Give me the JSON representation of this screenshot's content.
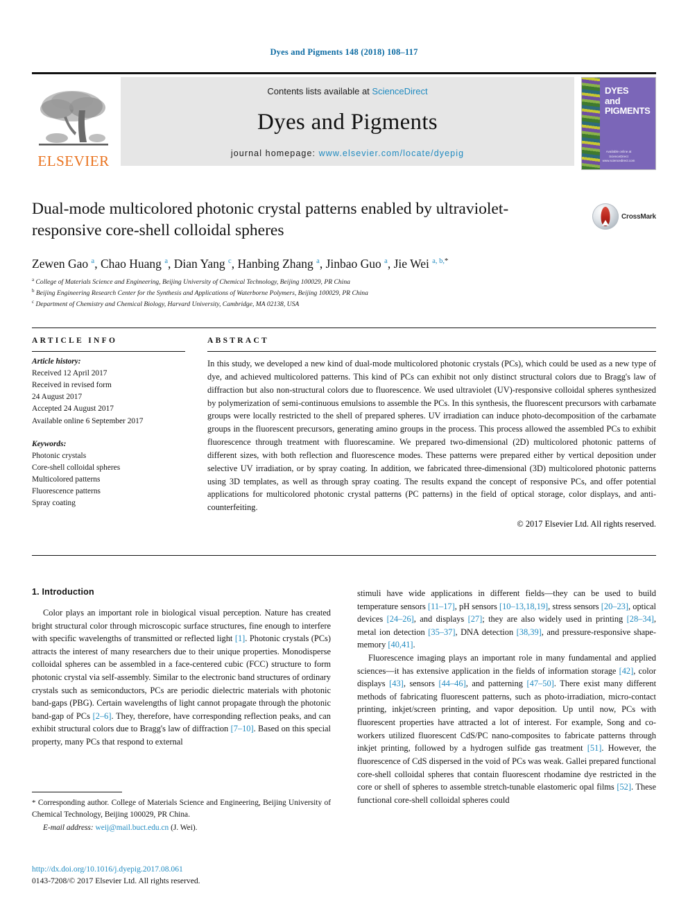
{
  "running_head": "Dyes and Pigments 148 (2018) 108–117",
  "masthead": {
    "publisher_logo_text": "ELSEVIER",
    "contents_prefix": "Contents lists available at ",
    "contents_link": "ScienceDirect",
    "journal_name": "Dyes and Pigments",
    "homepage_prefix": "journal homepage: ",
    "homepage_url": "www.elsevier.com/locate/dyepig",
    "cover": {
      "title_line1": "DYES",
      "title_line2": "and",
      "title_line3": "PIGMENTS",
      "footer_line1": "Available online at",
      "footer_line2": "ScienceDirect",
      "footer_line3": "www.sciencedirect.com"
    }
  },
  "article": {
    "title": "Dual-mode multicolored photonic crystal patterns enabled by ultraviolet-responsive core-shell colloidal spheres",
    "crossmark_label": "CrossMark",
    "authors": [
      {
        "name": "Zewen Gao",
        "marks": "a",
        "sep": ", "
      },
      {
        "name": "Chao Huang",
        "marks": "a",
        "sep": ", "
      },
      {
        "name": "Dian Yang",
        "marks": "c",
        "sep": ", "
      },
      {
        "name": "Hanbing Zhang",
        "marks": "a",
        "sep": ", "
      },
      {
        "name": "Jinbao Guo",
        "marks": "a",
        "sep": ", "
      },
      {
        "name": "Jie Wei",
        "marks": "a, b,",
        "star": "*",
        "sep": ""
      }
    ],
    "affiliations": [
      {
        "mark": "a",
        "text": "College of Materials Science and Engineering, Beijing University of Chemical Technology, Beijing 100029, PR China"
      },
      {
        "mark": "b",
        "text": "Beijing Engineering Research Center for the Synthesis and Applications of Waterborne Polymers, Beijing 100029, PR China"
      },
      {
        "mark": "c",
        "text": "Department of Chemistry and Chemical Biology, Harvard University, Cambridge, MA 02138, USA"
      }
    ]
  },
  "article_info": {
    "heading": "ARTICLE INFO",
    "history_label": "Article history:",
    "history": [
      "Received 12 April 2017",
      "Received in revised form",
      "24 August 2017",
      "Accepted 24 August 2017",
      "Available online 6 September 2017"
    ],
    "keywords_label": "Keywords:",
    "keywords": [
      "Photonic crystals",
      "Core-shell colloidal spheres",
      "Multicolored patterns",
      "Fluorescence patterns",
      "Spray coating"
    ]
  },
  "abstract": {
    "heading": "ABSTRACT",
    "text": "In this study, we developed a new kind of dual-mode multicolored photonic crystals (PCs), which could be used as a new type of dye, and achieved multicolored patterns. This kind of PCs can exhibit not only distinct structural colors due to Bragg's law of diffraction but also non-structural colors due to fluorescence. We used ultraviolet (UV)-responsive colloidal spheres synthesized by polymerization of semi-continuous emulsions to assemble the PCs. In this synthesis, the fluorescent precursors with carbamate groups were locally restricted to the shell of prepared spheres. UV irradiation can induce photo-decomposition of the carbamate groups in the fluorescent precursors, generating amino groups in the process. This process allowed the assembled PCs to exhibit fluorescence through treatment with fluorescamine. We prepared two-dimensional (2D) multicolored photonic patterns of different sizes, with both reflection and fluorescence modes. These patterns were prepared either by vertical deposition under selective UV irradiation, or by spray coating. In addition, we fabricated three-dimensional (3D) multicolored photonic patterns using 3D templates, as well as through spray coating. The results expand the concept of responsive PCs, and offer potential applications for multicolored photonic crystal patterns (PC patterns) in the field of optical storage, color displays, and anti-counterfeiting.",
    "copyright": "© 2017 Elsevier Ltd. All rights reserved."
  },
  "body": {
    "section_number_title": "1.  Introduction",
    "left_column": [
      {
        "segments": [
          {
            "t": "Color plays an important role in biological visual perception. Nature has created bright structural color through microscopic surface structures, fine enough to interfere with specific wavelengths of transmitted or reflected light ",
            "k": "p"
          },
          {
            "t": "[1]",
            "k": "r"
          },
          {
            "t": ". Photonic crystals (PCs) attracts the interest of many researchers due to their unique properties. Monodisperse colloidal spheres can be assembled in a face-centered cubic (FCC) structure to form photonic crystal via self-assembly. Similar to the electronic band structures of ordinary crystals such as semiconductors, PCs are periodic dielectric materials with photonic band-gaps (PBG). Certain wavelengths of light cannot propagate through the photonic band-gap of PCs ",
            "k": "p"
          },
          {
            "t": "[2–6]",
            "k": "r"
          },
          {
            "t": ". They, therefore, have corresponding reflection peaks, and can exhibit structural colors due to Bragg's law of diffraction ",
            "k": "p"
          },
          {
            "t": "[7–10]",
            "k": "r"
          },
          {
            "t": ". Based on this special property, many PCs that respond to external",
            "k": "p"
          }
        ]
      }
    ],
    "right_column": [
      {
        "indent": false,
        "segments": [
          {
            "t": "stimuli have wide applications in different fields—they can be used to build temperature sensors ",
            "k": "p"
          },
          {
            "t": "[11–17]",
            "k": "r"
          },
          {
            "t": ", pH sensors ",
            "k": "p"
          },
          {
            "t": "[10–13,18,19]",
            "k": "r"
          },
          {
            "t": ", stress sensors ",
            "k": "p"
          },
          {
            "t": "[20–23]",
            "k": "r"
          },
          {
            "t": ", optical devices ",
            "k": "p"
          },
          {
            "t": "[24–26]",
            "k": "r"
          },
          {
            "t": ", and displays ",
            "k": "p"
          },
          {
            "t": "[27]",
            "k": "r"
          },
          {
            "t": "; they are also widely used in printing ",
            "k": "p"
          },
          {
            "t": "[28–34]",
            "k": "r"
          },
          {
            "t": ", metal ion detection ",
            "k": "p"
          },
          {
            "t": "[35–37]",
            "k": "r"
          },
          {
            "t": ", DNA detection ",
            "k": "p"
          },
          {
            "t": "[38,39]",
            "k": "r"
          },
          {
            "t": ", and pressure-responsive shape-memory ",
            "k": "p"
          },
          {
            "t": "[40,41]",
            "k": "r"
          },
          {
            "t": ".",
            "k": "p"
          }
        ]
      },
      {
        "indent": true,
        "segments": [
          {
            "t": "Fluorescence imaging plays an important role in many fundamental and applied sciences—it has extensive application in the fields of information storage ",
            "k": "p"
          },
          {
            "t": "[42]",
            "k": "r"
          },
          {
            "t": ", color displays ",
            "k": "p"
          },
          {
            "t": "[43]",
            "k": "r"
          },
          {
            "t": ", sensors ",
            "k": "p"
          },
          {
            "t": "[44–46]",
            "k": "r"
          },
          {
            "t": ", and patterning ",
            "k": "p"
          },
          {
            "t": "[47–50]",
            "k": "r"
          },
          {
            "t": ". There exist many different methods of fabricating fluorescent patterns, such as photo-irradiation, micro-contact printing, inkjet/screen printing, and vapor deposition. Up until now, PCs with fluorescent properties have attracted a lot of interest. For example, Song and co-workers utilized fluorescent CdS/PC nano-composites to fabricate patterns through inkjet printing, followed by a hydrogen sulfide gas treatment ",
            "k": "p"
          },
          {
            "t": "[51]",
            "k": "r"
          },
          {
            "t": ". However, the fluorescence of CdS dispersed in the void of PCs was weak. Gallei prepared functional core-shell colloidal spheres that contain fluorescent rhodamine dye restricted in the core or shell of spheres to assemble stretch-tunable elastomeric opal films ",
            "k": "p"
          },
          {
            "t": "[52]",
            "k": "r"
          },
          {
            "t": ". These functional core-shell colloidal spheres could",
            "k": "p"
          }
        ]
      }
    ]
  },
  "footnote": {
    "star": "*",
    "corresponding": " Corresponding author. College of Materials Science and Engineering, Beijing University of Chemical Technology, Beijing 100029, PR China.",
    "email_label": "E-mail address:",
    "email": "weij@mail.buct.edu.cn",
    "email_suffix": " (J. Wei)."
  },
  "footer": {
    "doi": "http://dx.doi.org/10.1016/j.dyepig.2017.08.061",
    "issn": "0143-7208/© 2017 Elsevier Ltd. All rights reserved."
  },
  "colors": {
    "link": "#1f8ac0",
    "elsevier_orange": "#E9711C",
    "cover_purple": "#7b66b8"
  }
}
